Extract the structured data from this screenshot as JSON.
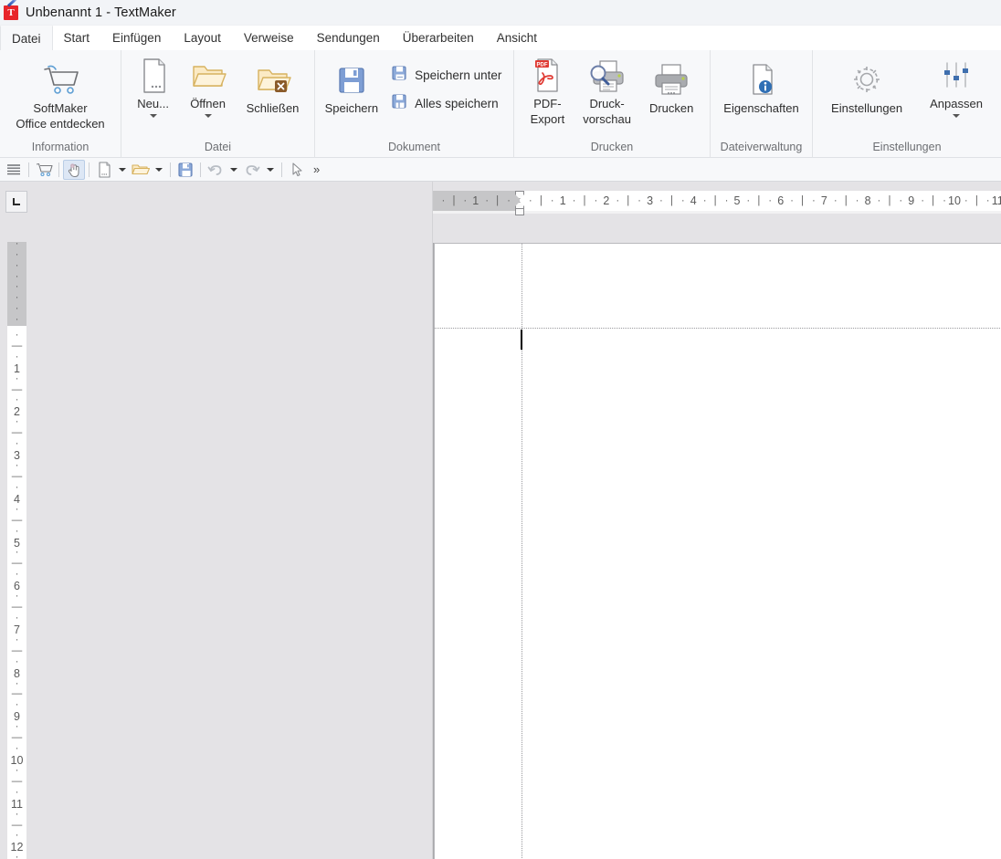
{
  "window": {
    "title": "Unbenannt 1 - TextMaker",
    "app_icon": "textmaker-icon"
  },
  "ribbon": {
    "tabs": [
      {
        "label": "Datei",
        "active": true
      },
      {
        "label": "Start",
        "active": false
      },
      {
        "label": "Einfügen",
        "active": false
      },
      {
        "label": "Layout",
        "active": false
      },
      {
        "label": "Verweise",
        "active": false
      },
      {
        "label": "Sendungen",
        "active": false
      },
      {
        "label": "Überarbeiten",
        "active": false
      },
      {
        "label": "Ansicht",
        "active": false
      }
    ],
    "groups": [
      {
        "label": "Information",
        "buttons": [
          {
            "label": "SoftMaker\nOffice entdecken",
            "icon": "shopping-cart-icon",
            "caret": false
          }
        ]
      },
      {
        "label": "Datei",
        "buttons": [
          {
            "label": "Neu...",
            "icon": "new-document-icon",
            "caret": true
          },
          {
            "label": "Öffnen",
            "icon": "open-folder-icon",
            "caret": true
          },
          {
            "label": "Schließen",
            "icon": "close-folder-icon",
            "caret": false
          }
        ]
      },
      {
        "label": "Dokument",
        "buttons": [
          {
            "label": "Speichern",
            "icon": "save-icon",
            "caret": false
          }
        ],
        "small_buttons": [
          {
            "label": "Speichern unter",
            "icon": "save-as-icon"
          },
          {
            "label": "Alles speichern",
            "icon": "save-all-icon"
          }
        ]
      },
      {
        "label": "Drucken",
        "buttons": [
          {
            "label": "PDF-\nExport",
            "icon": "pdf-export-icon",
            "caret": false
          },
          {
            "label": "Druck-\nvorschau",
            "icon": "print-preview-icon",
            "caret": false
          },
          {
            "label": "Drucken",
            "icon": "print-icon",
            "caret": false
          }
        ]
      },
      {
        "label": "Dateiverwaltung",
        "buttons": [
          {
            "label": "Eigenschaften",
            "icon": "document-properties-icon",
            "caret": false
          }
        ]
      },
      {
        "label": "Einstellungen",
        "buttons": [
          {
            "label": "Einstellungen",
            "icon": "gear-icon",
            "caret": false
          },
          {
            "label": "Anpassen",
            "icon": "sliders-icon",
            "caret": true
          }
        ]
      }
    ]
  },
  "quick_access": {
    "items": [
      {
        "icon": "menu-lines-icon",
        "name": "sidebar-toggle",
        "selected": false,
        "caret": false
      },
      {
        "sep": true
      },
      {
        "icon": "shopping-cart-icon",
        "name": "shop-button",
        "selected": false,
        "caret": false
      },
      {
        "sep": true
      },
      {
        "icon": "hand-touch-icon",
        "name": "touch-mode-button",
        "selected": true,
        "caret": false
      },
      {
        "sep": true
      },
      {
        "icon": "new-document-icon",
        "name": "new-document-button",
        "selected": false,
        "caret": true
      },
      {
        "icon": "open-folder-icon",
        "name": "open-button",
        "selected": false,
        "caret": true
      },
      {
        "sep": true
      },
      {
        "icon": "save-icon",
        "name": "save-button",
        "selected": false,
        "caret": false
      },
      {
        "sep": true
      },
      {
        "icon": "undo-icon",
        "name": "undo-button",
        "selected": false,
        "caret": true
      },
      {
        "icon": "redo-icon",
        "name": "redo-button",
        "selected": false,
        "caret": true
      },
      {
        "sep": true
      },
      {
        "icon": "pointer-icon",
        "name": "select-object-button",
        "selected": false,
        "caret": false
      }
    ],
    "overflow_label": "»"
  },
  "rulers": {
    "tab_stop_marker": "left-tab-stop",
    "horizontal": {
      "unit": "cm",
      "left_margin_labels": [
        "1"
      ],
      "labels": [
        "1",
        "2",
        "3",
        "4",
        "5",
        "6",
        "7",
        "8",
        "9",
        "10",
        "11"
      ],
      "indent_markers": [
        "first-line-indent",
        "hanging-indent",
        "left-indent"
      ]
    },
    "vertical": {
      "unit": "cm",
      "margin_labels": [
        "1"
      ],
      "labels": [
        "1",
        "2",
        "3",
        "4",
        "5",
        "6",
        "7",
        "8",
        "9",
        "10",
        "11",
        "12"
      ]
    }
  },
  "document": {
    "page_background": "#ffffff",
    "workspace_background": "#e4e3e6",
    "text_cursor_visible": true,
    "body_text": ""
  },
  "colors": {
    "title_bar": "#f2f4f7",
    "ribbon": "#f7f8fa",
    "accent_blue": "#4a78c0",
    "pdf_red": "#e8252a",
    "folder_yellow": "#f5d9a0",
    "group_label": "#6d6f73"
  }
}
